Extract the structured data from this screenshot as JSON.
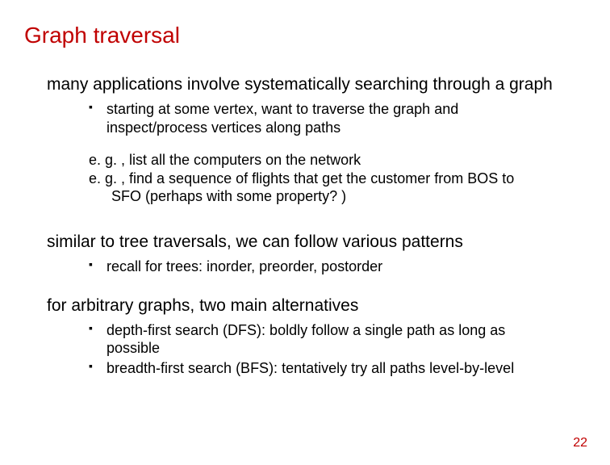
{
  "title": "Graph traversal",
  "sections": [
    {
      "text": "many applications involve systematically searching through a graph",
      "bullets": [
        "starting at some vertex, want to traverse the graph and inspect/process vertices along paths"
      ],
      "examples": [
        "e. g. , list all the computers on the network",
        "e. g. , find a sequence of flights that get the customer from BOS to",
        "SFO (perhaps with some property? )"
      ]
    },
    {
      "text": "similar to tree traversals, we can follow various patterns",
      "bullets": [
        "recall for trees: inorder, preorder, postorder"
      ]
    },
    {
      "text": "for arbitrary graphs, two main alternatives",
      "bullets": [
        "depth-first search (DFS): boldly follow a single path as long as possible",
        "breadth-first search (BFS): tentatively try all paths level-by-level"
      ]
    }
  ],
  "pageNumber": "22"
}
